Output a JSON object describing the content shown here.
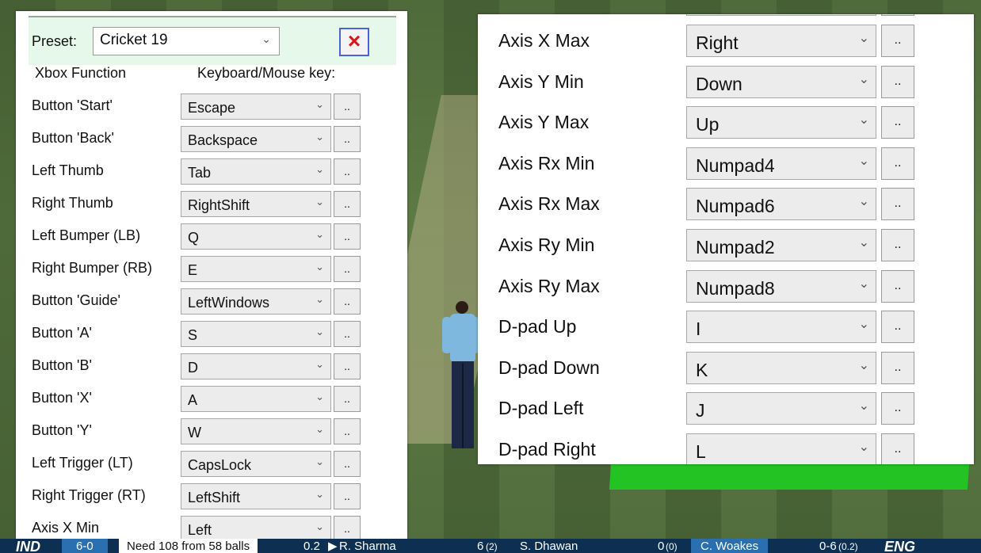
{
  "colors": {
    "accent": "#4a63d6",
    "delete": "#d81818",
    "mat": "#22c322",
    "scorebar": "#0d2f52"
  },
  "preset": {
    "label": "Preset:",
    "value": "Cricket 19",
    "delete_icon": "×"
  },
  "headers": {
    "function": "Xbox Function",
    "key": "Keyboard/Mouse key:"
  },
  "ui": {
    "chevron": "⌄",
    "dots": ".."
  },
  "left_mappings": [
    {
      "function": "Button 'Start'",
      "key": "Escape"
    },
    {
      "function": "Button 'Back'",
      "key": "Backspace"
    },
    {
      "function": "Left Thumb",
      "key": "Tab"
    },
    {
      "function": "Right Thumb",
      "key": "RightShift"
    },
    {
      "function": "Left Bumper (LB)",
      "key": "Q"
    },
    {
      "function": "Right Bumper (RB)",
      "key": "E"
    },
    {
      "function": "Button 'Guide'",
      "key": "LeftWindows"
    },
    {
      "function": "Button 'A'",
      "key": "S"
    },
    {
      "function": "Button 'B'",
      "key": "D"
    },
    {
      "function": "Button 'X'",
      "key": "A"
    },
    {
      "function": "Button 'Y'",
      "key": "W"
    },
    {
      "function": "Left Trigger (LT)",
      "key": "CapsLock"
    },
    {
      "function": "Right Trigger (RT)",
      "key": "LeftShift"
    },
    {
      "function": "Axis X Min",
      "key": "Left"
    }
  ],
  "right_mappings": [
    {
      "function": "Axis X Max",
      "key": "Right"
    },
    {
      "function": "Axis Y Min",
      "key": "Down"
    },
    {
      "function": "Axis Y Max",
      "key": "Up"
    },
    {
      "function": "Axis Rx Min",
      "key": "Numpad4"
    },
    {
      "function": "Axis Rx Max",
      "key": "Numpad6"
    },
    {
      "function": "Axis Ry Min",
      "key": "Numpad2"
    },
    {
      "function": "Axis Ry Max",
      "key": "Numpad8"
    },
    {
      "function": "D-pad Up",
      "key": "I"
    },
    {
      "function": "D-pad Down",
      "key": "K"
    },
    {
      "function": "D-pad Left",
      "key": "J"
    },
    {
      "function": "D-pad Right",
      "key": "L"
    }
  ],
  "scorebar": {
    "team1": "IND",
    "score": "6-0",
    "need": "Need 108 from 58 balls",
    "overs": "0.2",
    "batter1": "R. Sharma",
    "batter1_runs": "6",
    "batter1_balls": "(2)",
    "batter2": "S. Dhawan",
    "batter2_runs": "0",
    "batter2_balls": "(0)",
    "bowler": "C. Woakes",
    "bowler_figures": "0-6",
    "bowler_overs": "(0.2)",
    "team2": "ENG"
  }
}
